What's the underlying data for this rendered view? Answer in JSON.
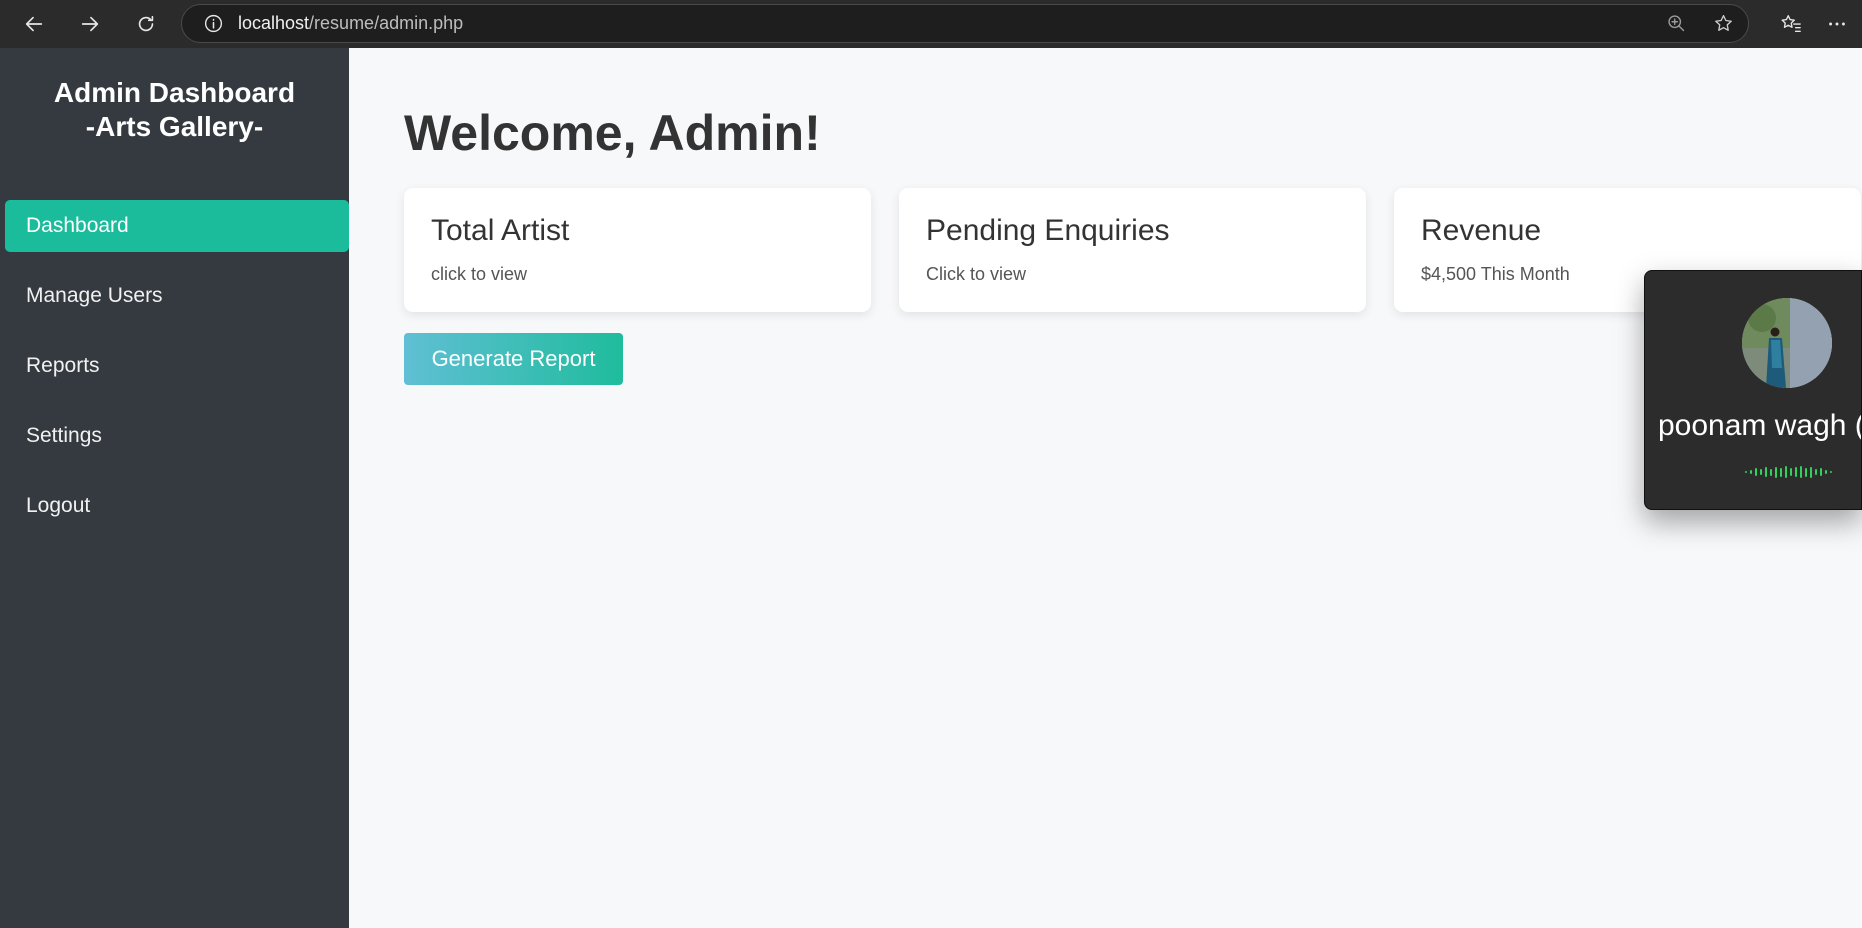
{
  "browser": {
    "url_host": "localhost",
    "url_path": "/resume/admin.php"
  },
  "sidebar": {
    "brand_line1": "Admin Dashboard",
    "brand_line2": "-Arts Gallery-",
    "items": [
      {
        "label": "Dashboard",
        "active": true
      },
      {
        "label": "Manage Users",
        "active": false
      },
      {
        "label": "Reports",
        "active": false
      },
      {
        "label": "Settings",
        "active": false
      },
      {
        "label": "Logout",
        "active": false
      }
    ]
  },
  "main": {
    "welcome": "Welcome, Admin!",
    "cards": [
      {
        "title": "Total Artist",
        "subtitle": "click to view"
      },
      {
        "title": "Pending Enquiries",
        "subtitle": "Click to view"
      },
      {
        "title": "Revenue",
        "subtitle": "$4,500 This Month"
      }
    ],
    "generate_button": "Generate Report"
  },
  "call_overlay": {
    "caller_name": "poonam wagh ("
  },
  "colors": {
    "sidebar_bg": "#343a40",
    "accent": "#1abc9c",
    "page_bg": "#f7f8fa"
  }
}
